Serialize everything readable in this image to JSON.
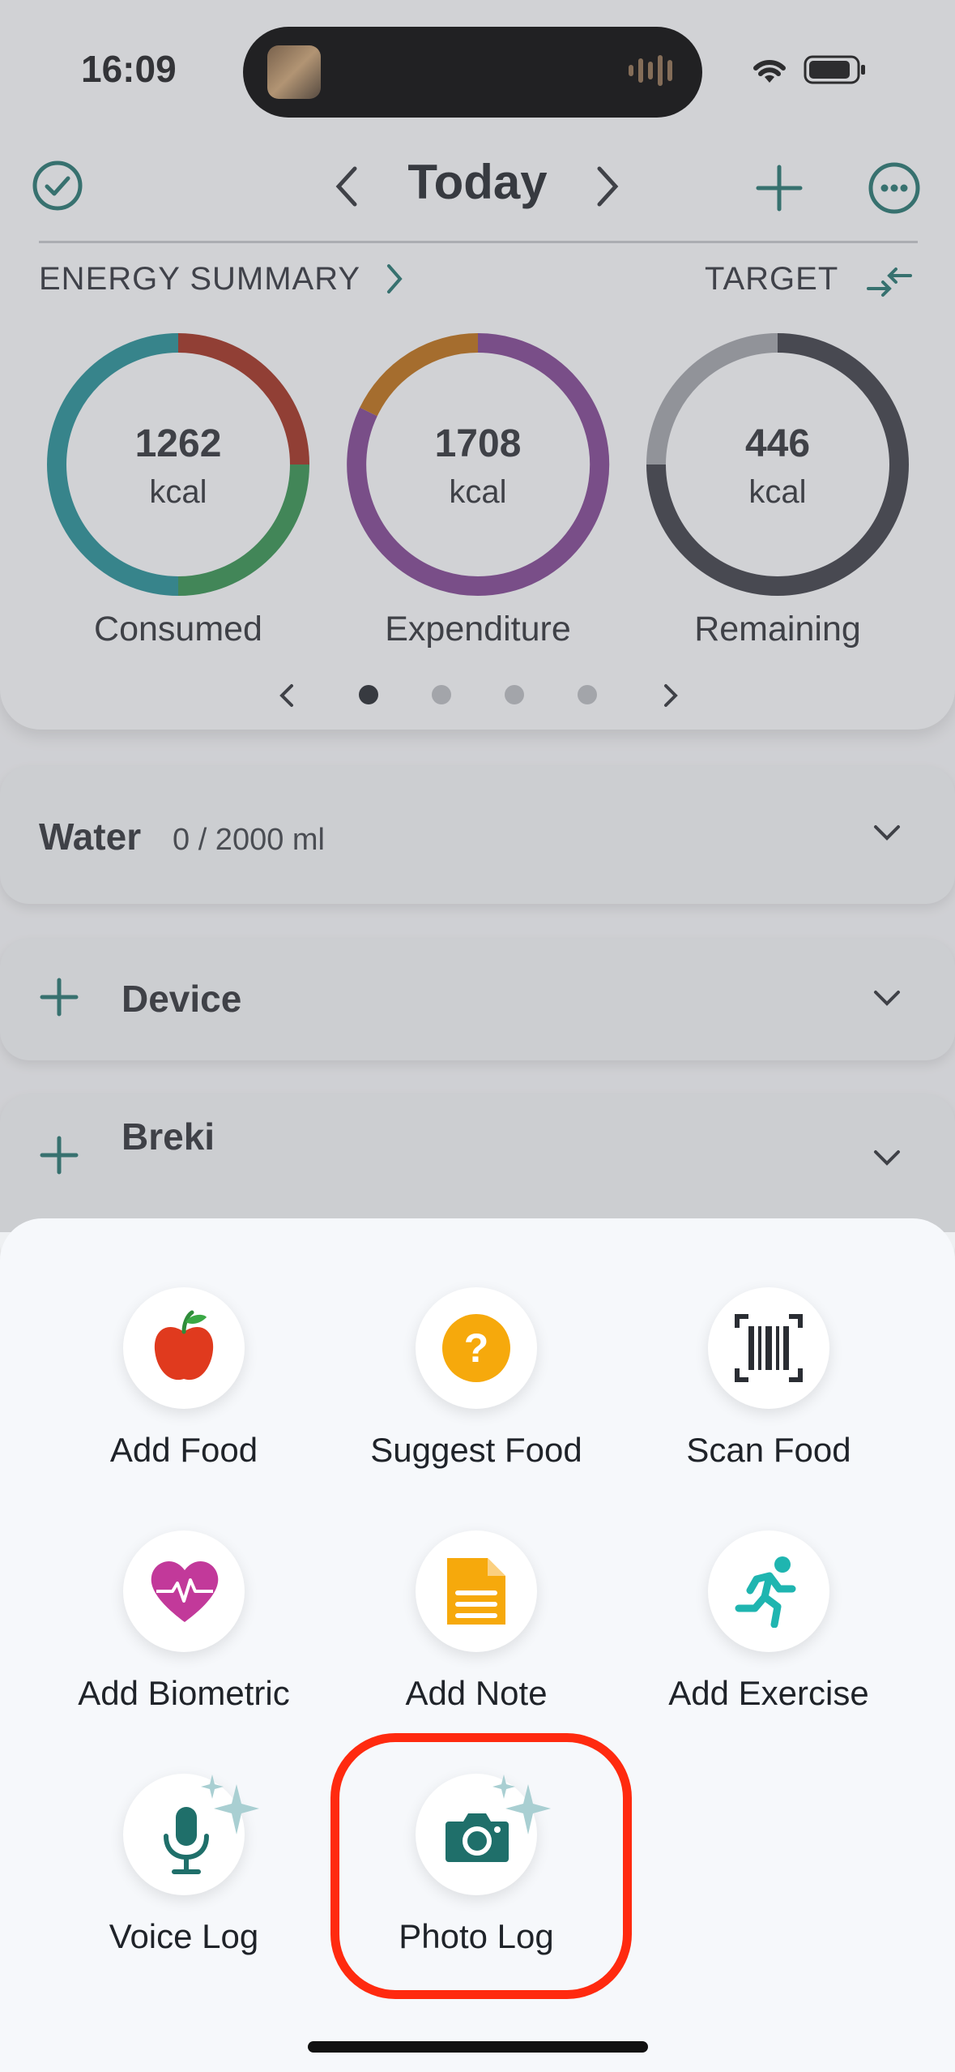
{
  "status": {
    "time": "16:09"
  },
  "header": {
    "title": "Today"
  },
  "energy": {
    "section_label": "ENERGY SUMMARY",
    "target_label": "TARGET",
    "consumed": {
      "value": "1262",
      "unit": "kcal",
      "label": "Consumed"
    },
    "expenditure": {
      "value": "1708",
      "unit": "kcal",
      "label": "Expenditure"
    },
    "remaining": {
      "value": "446",
      "unit": "kcal",
      "label": "Remaining"
    },
    "page_indicator": {
      "current": 1,
      "total": 4
    }
  },
  "water": {
    "label": "Water",
    "amount": "0 / 2000 ml"
  },
  "device": {
    "label": "Device"
  },
  "breki": {
    "label": "Breki"
  },
  "actions": {
    "add_food": "Add Food",
    "suggest_food": "Suggest Food",
    "scan_food": "Scan Food",
    "add_biometric": "Add Biometric",
    "add_note": "Add Note",
    "add_exercise": "Add Exercise",
    "voice_log": "Voice Log",
    "photo_log": "Photo Log"
  },
  "colors": {
    "accent": "#1f6f6a",
    "highlight": "#ff2a0f",
    "consumed_teal": "#1f8a90",
    "consumed_red": "#9b2a1a",
    "consumed_green": "#2f8c4a",
    "expenditure_purple": "#7a3f8c",
    "expenditure_orange": "#b86a10",
    "remaining_dark": "#363840",
    "remaining_gray": "#9b9ea4"
  },
  "icons": [
    "check-circle-icon",
    "chevron-left-icon",
    "chevron-right-icon",
    "plus-icon",
    "more-icon",
    "swap-icon",
    "chevron-down-icon",
    "apple-icon",
    "question-icon",
    "barcode-icon",
    "heart-pulse-icon",
    "note-icon",
    "running-icon",
    "microphone-icon",
    "camera-icon",
    "sparkle-icon"
  ]
}
